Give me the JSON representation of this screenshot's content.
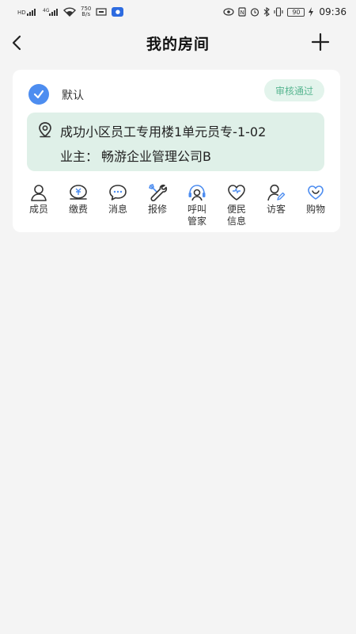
{
  "status_bar": {
    "net_speed_value": "750",
    "net_speed_unit": "B/s",
    "battery": "90",
    "time": "09:36",
    "icons": [
      "sim-1-icon",
      "sim-2-icon",
      "wifi-icon",
      "nfc-icon",
      "alarm-icon",
      "bluetooth-icon",
      "vibrate-icon",
      "battery-icon",
      "charging-icon"
    ]
  },
  "header": {
    "title": "我的房间",
    "back_icon": "chevron-left-icon",
    "add_icon": "plus-icon"
  },
  "card": {
    "default_label": "默认",
    "status_badge": "审核通过",
    "address": "成功小区员工专用楼1单元员专-1-02",
    "owner_prefix": "业主：",
    "owner_name": "畅游企业管理公司B",
    "actions": [
      {
        "label": "成员",
        "icon": "person-icon"
      },
      {
        "label": "缴费",
        "icon": "payment-icon"
      },
      {
        "label": "消息",
        "icon": "message-icon"
      },
      {
        "label": "报修",
        "icon": "repair-icon"
      },
      {
        "label": "呼叫管家",
        "icon": "call-steward-icon"
      },
      {
        "label": "便民信息",
        "icon": "heart-info-icon"
      },
      {
        "label": "访客",
        "icon": "visitor-icon"
      },
      {
        "label": "购物",
        "icon": "shopping-icon"
      }
    ]
  },
  "colors": {
    "accent_blue": "#4d8df0",
    "badge_bg": "#e3f4ec",
    "badge_text": "#58b691",
    "address_bg": "#dff0e8",
    "page_bg": "#f4f4f4"
  }
}
